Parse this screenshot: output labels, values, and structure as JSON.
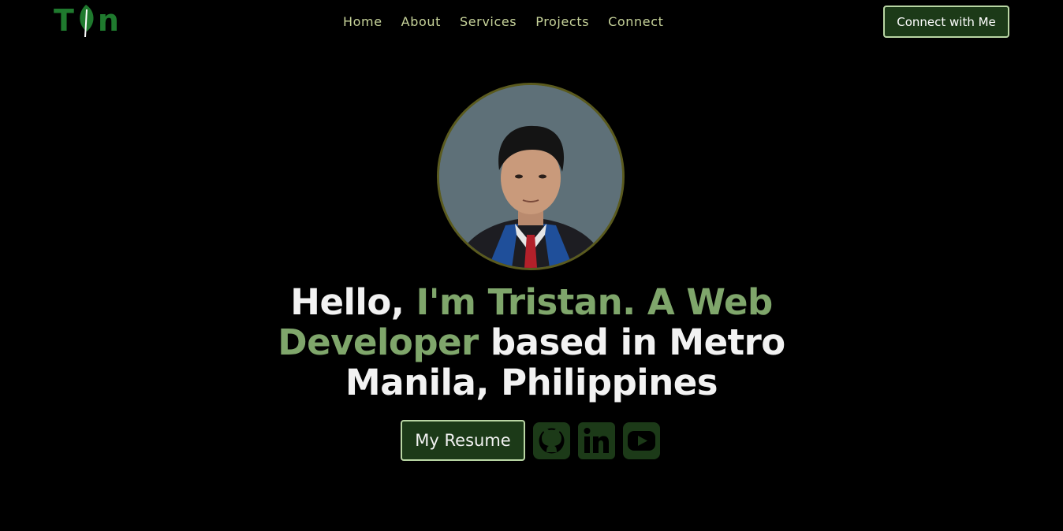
{
  "header": {
    "logo_parts": [
      "T",
      "n"
    ],
    "logo_icon": "leaf-icon",
    "nav": [
      {
        "label": "Home"
      },
      {
        "label": "About"
      },
      {
        "label": "Services"
      },
      {
        "label": "Projects"
      },
      {
        "label": "Connect"
      }
    ],
    "cta_label": "Connect with Me"
  },
  "hero": {
    "avatar_alt": "profile-photo",
    "headline": {
      "part1": "Hello, ",
      "accent1": "I'm Tristan. A Web Developer",
      "part2": " based in Metro Manila, Philippines"
    },
    "resume_label": "My Resume",
    "social_icons": [
      "github-icon",
      "linkedin-icon",
      "youtube-icon"
    ]
  },
  "colors": {
    "background": "#000000",
    "brand_green": "#1f7a2e",
    "accent_text": "#7fa66b",
    "nav_text": "#c7d39a",
    "button_bg": "#1c3a18",
    "button_border": "#b9d6a4",
    "social_icon": "#1c3a18"
  }
}
